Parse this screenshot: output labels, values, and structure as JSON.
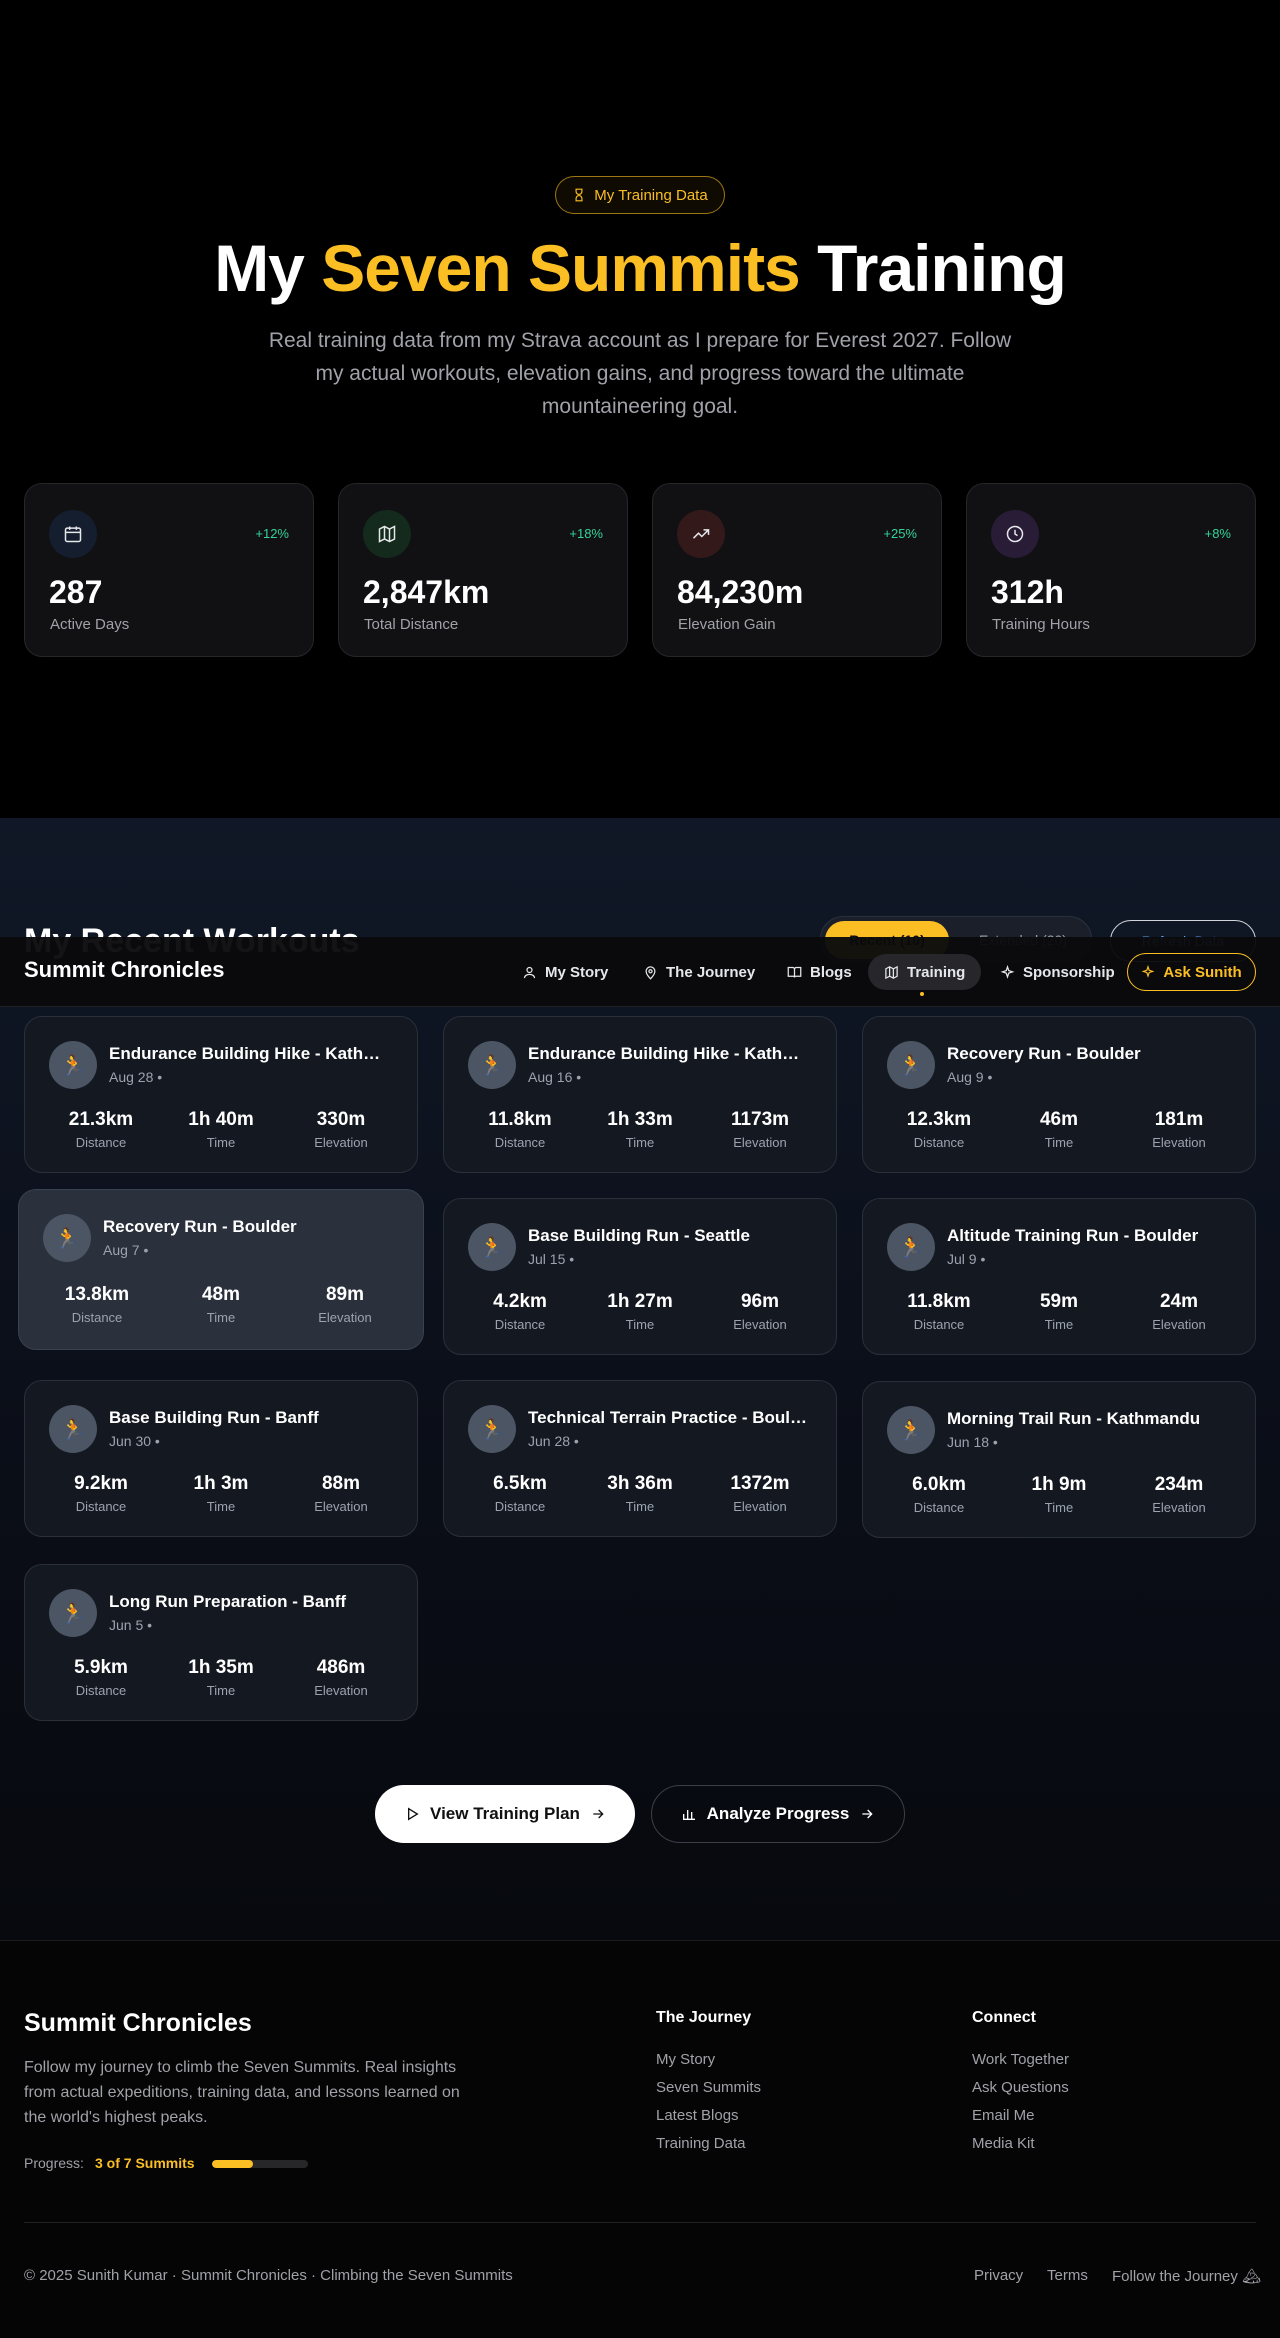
{
  "hero": {
    "badge": "My Training Data",
    "title_pre": "My ",
    "title_accent": "Seven Summits",
    "title_post": " Training",
    "subtitle": "Real training data from my Strava account as I prepare for Everest 2027. Follow my actual workouts, elevation gains, and progress toward the ultimate mountaineering goal."
  },
  "stats": [
    {
      "icon": "calendar-icon",
      "value": "287",
      "label": "Active Days",
      "change": "+12%",
      "accent": "#3b82f6"
    },
    {
      "icon": "map-icon",
      "value": "2,847km",
      "label": "Total Distance",
      "change": "+18%",
      "accent": "#22c55e"
    },
    {
      "icon": "trending-up-icon",
      "value": "84,230m",
      "label": "Elevation Gain",
      "change": "+25%",
      "accent": "#ef4444"
    },
    {
      "icon": "clock-icon",
      "value": "312h",
      "label": "Training Hours",
      "change": "+8%",
      "accent": "#a855f7"
    }
  ],
  "workouts_section": {
    "title": "My Recent Workouts",
    "filter_active": "Recent (10)",
    "filter_other": "Extended (20)",
    "filter_button": "Refresh Data"
  },
  "nav": {
    "brand": "Summit Chronicles",
    "items": [
      {
        "label": "My Story",
        "icon": "user-icon"
      },
      {
        "label": "The Journey",
        "icon": "map-pin-icon"
      },
      {
        "label": "Blogs",
        "icon": "book-icon"
      },
      {
        "label": "Training",
        "icon": "map-icon"
      },
      {
        "label": "Sponsorship",
        "icon": "sparkle-icon"
      }
    ],
    "active": "Training",
    "ask_button": "Ask Sunith"
  },
  "workouts": [
    {
      "title": "Endurance Building Hike - Kathmandu",
      "date": "Aug 28 •",
      "distance": "21.3km",
      "time": "1h 40m",
      "elevation": "330m"
    },
    {
      "title": "Endurance Building Hike - Kathmandu",
      "date": "Aug 16 •",
      "distance": "11.8km",
      "time": "1h 33m",
      "elevation": "1173m"
    },
    {
      "title": "Recovery Run - Boulder",
      "date": "Aug 9 •",
      "distance": "12.3km",
      "time": "46m",
      "elevation": "181m"
    },
    {
      "title": "Recovery Run - Boulder",
      "date": "Aug 7 •",
      "distance": "13.8km",
      "time": "48m",
      "elevation": "89m"
    },
    {
      "title": "Base Building Run - Seattle",
      "date": "Jul 15 •",
      "distance": "4.2km",
      "time": "1h 27m",
      "elevation": "96m"
    },
    {
      "title": "Altitude Training Run - Boulder",
      "date": "Jul 9 •",
      "distance": "11.8km",
      "time": "59m",
      "elevation": "24m"
    },
    {
      "title": "Base Building Run - Banff",
      "date": "Jun 30 •",
      "distance": "9.2km",
      "time": "1h 3m",
      "elevation": "88m"
    },
    {
      "title": "Technical Terrain Practice - Boulder",
      "date": "Jun 28 •",
      "distance": "6.5km",
      "time": "3h 36m",
      "elevation": "1372m"
    },
    {
      "title": "Morning Trail Run - Kathmandu",
      "date": "Jun 18 •",
      "distance": "6.0km",
      "time": "1h 9m",
      "elevation": "234m"
    },
    {
      "title": "Long Run Preparation - Banff",
      "date": "Jun 5 •",
      "distance": "5.9km",
      "time": "1h 35m",
      "elevation": "486m"
    }
  ],
  "stat_labels": {
    "distance": "Distance",
    "time": "Time",
    "elevation": "Elevation"
  },
  "cta": {
    "primary": "View Training Plan",
    "secondary": "Analyze Progress"
  },
  "footer": {
    "brand": "Summit Chronicles",
    "description": "Follow my journey to climb the Seven Summits. Real insights from actual expeditions, training data, and lessons learned on the world's highest peaks.",
    "progress_label": "Progress:",
    "progress_value": "3 of 7 Summits",
    "progress_fraction": 0.43,
    "journey_title": "The Journey",
    "journey_links": [
      "My Story",
      "Seven Summits",
      "Latest Blogs",
      "Training Data"
    ],
    "connect_title": "Connect",
    "connect_links": [
      "Work Together",
      "Ask Questions",
      "Email Me",
      "Media Kit"
    ],
    "copyright": "© 2025 Sunith Kumar · Summit Chronicles · Climbing the Seven Summits",
    "bottom_links": [
      "Privacy",
      "Terms",
      "Follow the Journey 🏔"
    ]
  },
  "colors": {
    "accent": "#fbbf24",
    "positive": "#34d399"
  }
}
